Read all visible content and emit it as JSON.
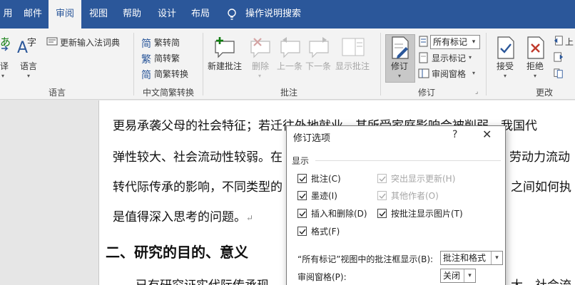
{
  "tabs": [
    {
      "label": "用",
      "active": false
    },
    {
      "label": "邮件",
      "active": false
    },
    {
      "label": "审阅",
      "active": true
    },
    {
      "label": "视图",
      "active": false
    },
    {
      "label": "帮助",
      "active": false
    },
    {
      "label": "设计",
      "active": false
    },
    {
      "label": "布局",
      "active": false
    }
  ],
  "tell_me": "操作说明搜索",
  "ribbon": {
    "lang": {
      "translate": "译",
      "language": "语言",
      "update_ime": "更新输入法词典",
      "group": "语言"
    },
    "chinese": {
      "to_simplified": "繁转简",
      "to_traditional": "简转繁",
      "convert": "简繁转换",
      "group": "中文简繁转换"
    },
    "comments": {
      "new": "新建批注",
      "delete": "删除",
      "prev": "上一条",
      "next": "下一条",
      "show": "显示批注",
      "group": "批注"
    },
    "tracking": {
      "track": "修订",
      "all_markup": "所有标记",
      "show_markup": "显示标记",
      "review_pane": "审阅窗格",
      "group": "修订"
    },
    "changes": {
      "accept": "接受",
      "reject": "拒绝",
      "group": "更改",
      "prev_partial": "上"
    }
  },
  "document": {
    "lines": [
      "更易承袭父母的社会特征；若迁往外地就业，其所受家庭影响会被削弱。我国代",
      "弹性较大、社会流动性较弱。在",
      "转代际传承的影响，不同类型的",
      "是值得深入思考的问题。"
    ],
    "right_frag1": "劳动力流动",
    "right_frag2": "之间如何执",
    "heading": "二、研究的目的、意义",
    "last_line_left": "已有研究证实代际传承现",
    "last_line_right": "大，社会流",
    "para_mark": "↵"
  },
  "dialog": {
    "title": "修订选项",
    "help": "?",
    "close": "✕",
    "section": "显示",
    "options": [
      {
        "label": "批注(C)",
        "checked": true,
        "disabled": false
      },
      {
        "label": "墨迹(I)",
        "checked": true,
        "disabled": false
      },
      {
        "label": "插入和删除(D)",
        "checked": true,
        "disabled": false
      },
      {
        "label": "格式(F)",
        "checked": true,
        "disabled": false
      },
      {
        "label": "突出显示更新(H)",
        "checked": true,
        "disabled": true
      },
      {
        "label": "其他作者(O)",
        "checked": true,
        "disabled": true
      },
      {
        "label": "按批注显示图片(T)",
        "checked": true,
        "disabled": false
      }
    ],
    "balloons_label": "“所有标记”视图中的批注框显示(B):",
    "balloons_value": "批注和格式",
    "pane_label": "审阅窗格(P):",
    "pane_value": "关闭"
  },
  "colors": {
    "tabbar": "#2b579a",
    "ribbon": "#f3f3f3",
    "accent_green": "#107c10",
    "accent_blue": "#2b579a",
    "reject_red": "#c0392b"
  }
}
